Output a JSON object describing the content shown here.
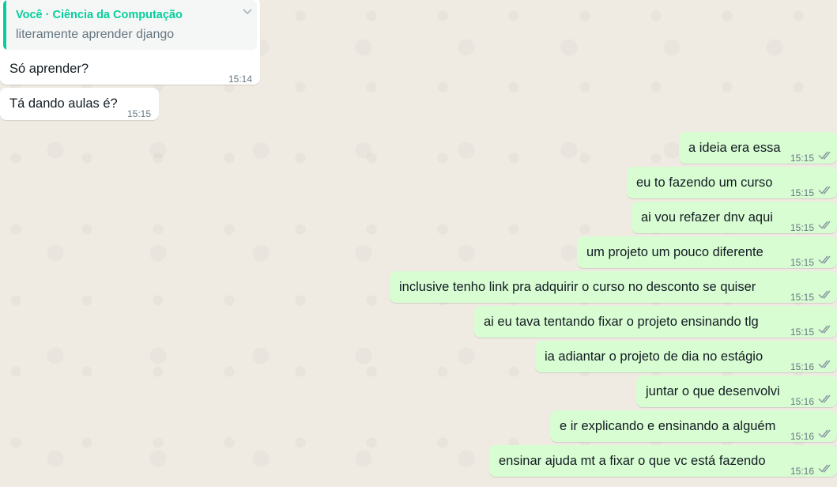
{
  "chat": {
    "reply": {
      "author": "Você · Ciência da Computação",
      "quoted_text": "literamente aprender django",
      "text": "Só aprender?",
      "time": "15:14"
    },
    "incoming": [
      {
        "text": "Tá dando aulas é?",
        "time": "15:15"
      }
    ],
    "outgoing": [
      {
        "text": "a ideia era essa",
        "time": "15:15"
      },
      {
        "text": "eu to fazendo um curso",
        "time": "15:15"
      },
      {
        "text": "ai vou refazer dnv aqui",
        "time": "15:15"
      },
      {
        "text": "um projeto um pouco diferente",
        "time": "15:15"
      },
      {
        "text": "inclusive tenho link pra adquirir o curso no desconto se quiser",
        "time": "15:15"
      },
      {
        "text": "ai eu tava tentando fixar o projeto ensinando tlg",
        "time": "15:15"
      },
      {
        "text": "ia adiantar o projeto de dia no estágio",
        "time": "15:16"
      },
      {
        "text": "juntar o que desenvolvi",
        "time": "15:16"
      },
      {
        "text": "e ir explicando e ensinando a alguém",
        "time": "15:16"
      },
      {
        "text": "ensinar ajuda mt a fixar o que vc está fazendo",
        "time": "15:16"
      }
    ]
  },
  "icons": {
    "read_receipt": "double-check-icon",
    "menu": "chevron-down-icon"
  },
  "colors": {
    "wallpaper": "#efeae2",
    "incoming_bubble": "#ffffff",
    "outgoing_bubble": "#d9fdd3",
    "quote_accent": "#06cf9c",
    "read_tick": "#8696a0"
  }
}
